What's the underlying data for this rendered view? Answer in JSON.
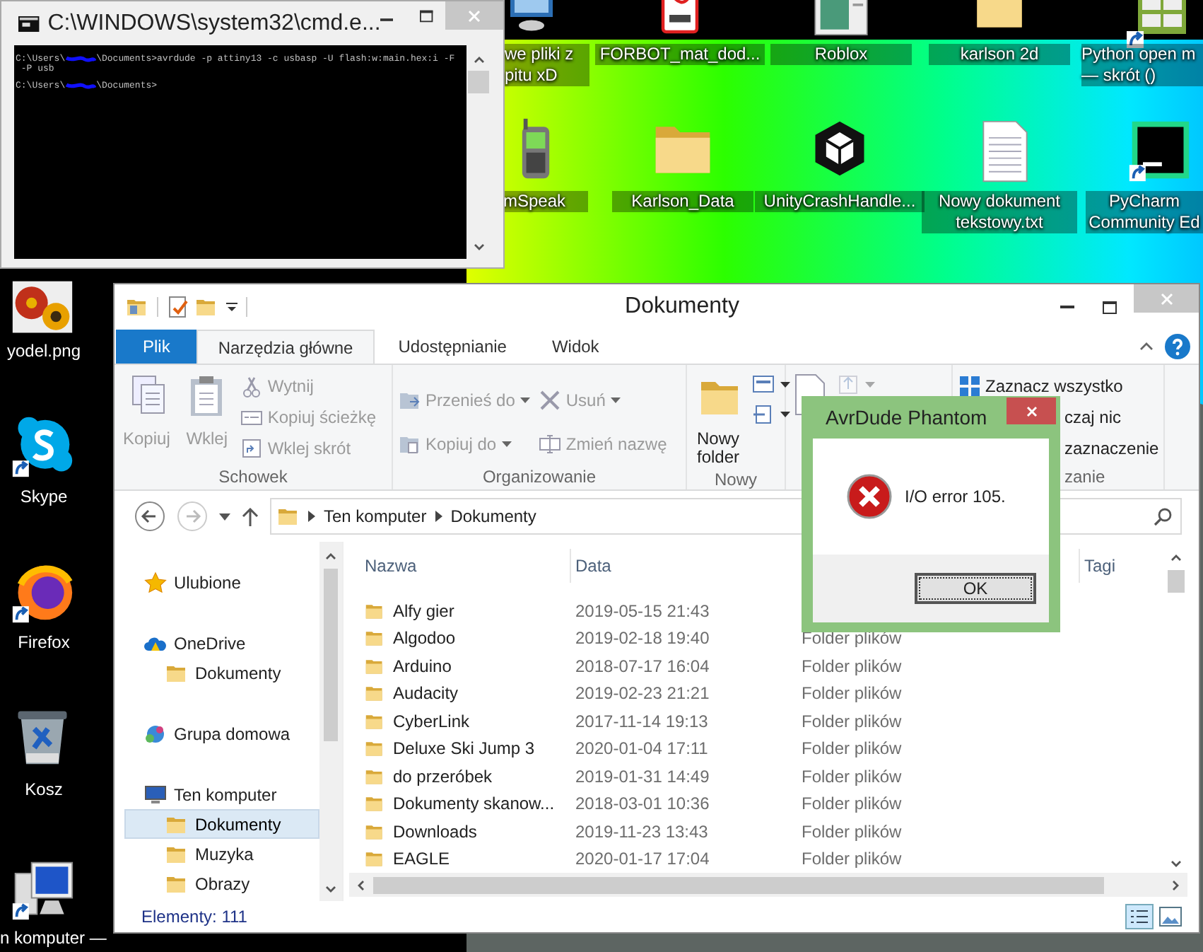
{
  "desktop": {
    "icons": [
      {
        "label": "we pliki z\npitu xD",
        "shortcut": false
      },
      {
        "label": "FORBOT_mat_dod...",
        "shortcut": false
      },
      {
        "label": "Roblox",
        "shortcut": false
      },
      {
        "label": "karlson 2d",
        "shortcut": false
      },
      {
        "label": "Python open m\n— skrót ()",
        "shortcut": true
      },
      {
        "label": "mSpeak",
        "shortcut": false
      },
      {
        "label": "Karlson_Data",
        "shortcut": false
      },
      {
        "label": "UnityCrashHandle...",
        "shortcut": false
      },
      {
        "label": "Nowy dokument\ntekstowy.txt",
        "shortcut": false
      },
      {
        "label": "PyCharm\nCommunity Ed",
        "shortcut": true
      },
      {
        "label": "yodel.png",
        "shortcut": false
      },
      {
        "label": "Skype",
        "shortcut": true
      },
      {
        "label": "Firefox",
        "shortcut": true
      },
      {
        "label": "Kosz",
        "shortcut": false
      },
      {
        "label": "n komputer —",
        "shortcut": true
      }
    ]
  },
  "cmd_window": {
    "title": "C:\\WINDOWS\\system32\\cmd.e...",
    "lines": [
      {
        "gap_before": false,
        "segments": [
          {
            "kind": "text",
            "text": "C:\\Users\\"
          },
          {
            "kind": "redacted"
          },
          {
            "kind": "text",
            "text": "\\Documents>avrdude -p attiny13 -c usbasp -U flash:w:main.hex:i -F"
          }
        ]
      },
      {
        "gap_before": false,
        "segments": [
          {
            "kind": "text",
            "text": " -P usb"
          }
        ]
      },
      {
        "gap_before": true,
        "segments": [
          {
            "kind": "text",
            "text": "C:\\Users\\"
          },
          {
            "kind": "redacted"
          },
          {
            "kind": "text",
            "text": "\\Documents>"
          }
        ]
      }
    ]
  },
  "explorer": {
    "title": "Dokumenty",
    "tabs": [
      {
        "label": "Plik",
        "kind": "file",
        "selected": false
      },
      {
        "label": "Narzędzia główne",
        "kind": "tab",
        "selected": true
      },
      {
        "label": "Udostępnianie",
        "kind": "tab",
        "selected": false
      },
      {
        "label": "Widok",
        "kind": "tab",
        "selected": false
      }
    ],
    "ribbon_groups": [
      {
        "label": "Schowek",
        "columns": [
          [
            {
              "kind": "large",
              "label": "Kopiuj",
              "disabled": true
            }
          ],
          [
            {
              "kind": "large",
              "label": "Wklej",
              "disabled": true
            }
          ],
          [
            {
              "kind": "small",
              "label": "Wytnij",
              "disabled": true
            },
            {
              "kind": "small",
              "label": "Kopiuj ścieżkę",
              "disabled": true
            },
            {
              "kind": "small",
              "label": "Wklej skrót",
              "disabled": true
            }
          ]
        ]
      },
      {
        "label": "Organizowanie",
        "columns": [
          [
            {
              "kind": "small",
              "label": "Przenieś do",
              "disabled": true,
              "has_menu": true
            },
            {
              "kind": "small",
              "label": "Kopiuj do",
              "disabled": true,
              "has_menu": true
            }
          ],
          [
            {
              "kind": "small",
              "label": "Usuń",
              "disabled": true,
              "has_menu": true
            },
            {
              "kind": "small",
              "label": "Zmień nazwę",
              "disabled": true
            }
          ]
        ]
      },
      {
        "label": "Nowy",
        "columns": [
          [
            {
              "kind": "large",
              "label": "Nowy\nfolder",
              "disabled": false
            }
          ],
          [
            {
              "kind": "icon",
              "disabled": false,
              "has_menu": true
            },
            {
              "kind": "icon",
              "disabled": false,
              "has_menu": true
            }
          ]
        ]
      },
      {
        "columns": [
          [
            {
              "kind": "large_icon",
              "disabled": false
            }
          ],
          [
            {
              "kind": "icon",
              "disabled": true,
              "has_menu": true
            }
          ]
        ]
      },
      {
        "label": "zanie",
        "obscured": true,
        "columns": [
          [
            {
              "kind": "small",
              "label": "Zaznacz wszystko",
              "disabled": false
            },
            {
              "kind": "small",
              "label": "czaj nic",
              "disabled": false,
              "obscured": true
            },
            {
              "kind": "small",
              "label": "zaznaczenie",
              "disabled": false,
              "obscured": true
            }
          ]
        ]
      }
    ],
    "breadcrumb": [
      "Ten komputer",
      "Dokumenty"
    ],
    "nav": [
      {
        "label": "Ulubione",
        "selected": false
      },
      {
        "label": "OneDrive",
        "selected": false,
        "children": [
          {
            "label": "Dokumenty",
            "selected": false
          }
        ]
      },
      {
        "label": "Grupa domowa",
        "selected": false
      },
      {
        "label": "Ten komputer",
        "selected": false,
        "children": [
          {
            "label": "Dokumenty",
            "selected": true
          },
          {
            "label": "Muzyka",
            "selected": false
          },
          {
            "label": "Obrazy",
            "selected": false
          }
        ]
      }
    ],
    "columns": [
      {
        "label": "Nazwa"
      },
      {
        "label": "Data"
      },
      {
        "label": "Tagi"
      }
    ],
    "rows": [
      {
        "name": "Alfy gier",
        "date": "2019-05-15 21:43"
      },
      {
        "name": "Algodoo",
        "date": "2019-02-18 19:40",
        "type": "Folder plików"
      },
      {
        "name": "Arduino",
        "date": "2018-07-17 16:04",
        "type": "Folder plików"
      },
      {
        "name": "Audacity",
        "date": "2019-02-23 21:21",
        "type": "Folder plików"
      },
      {
        "name": "CyberLink",
        "date": "2017-11-14 19:13",
        "type": "Folder plików"
      },
      {
        "name": "Deluxe Ski Jump 3",
        "date": "2020-01-04 17:11",
        "type": "Folder plików"
      },
      {
        "name": "do przeróbek",
        "date": "2019-01-31 14:49",
        "type": "Folder plików"
      },
      {
        "name": "Dokumenty skanow...",
        "date": "2018-03-01 10:36",
        "type": "Folder plików"
      },
      {
        "name": "Downloads",
        "date": "2019-11-23 13:43",
        "type": "Folder plików"
      },
      {
        "name": "EAGLE",
        "date": "2020-01-17 17:04",
        "type": "Folder plików"
      }
    ],
    "status_bar": {
      "items": "Elementy: 111"
    }
  },
  "dialog": {
    "title": "AvrDude Phantom",
    "message": "I/O error 105.",
    "button": "OK"
  }
}
